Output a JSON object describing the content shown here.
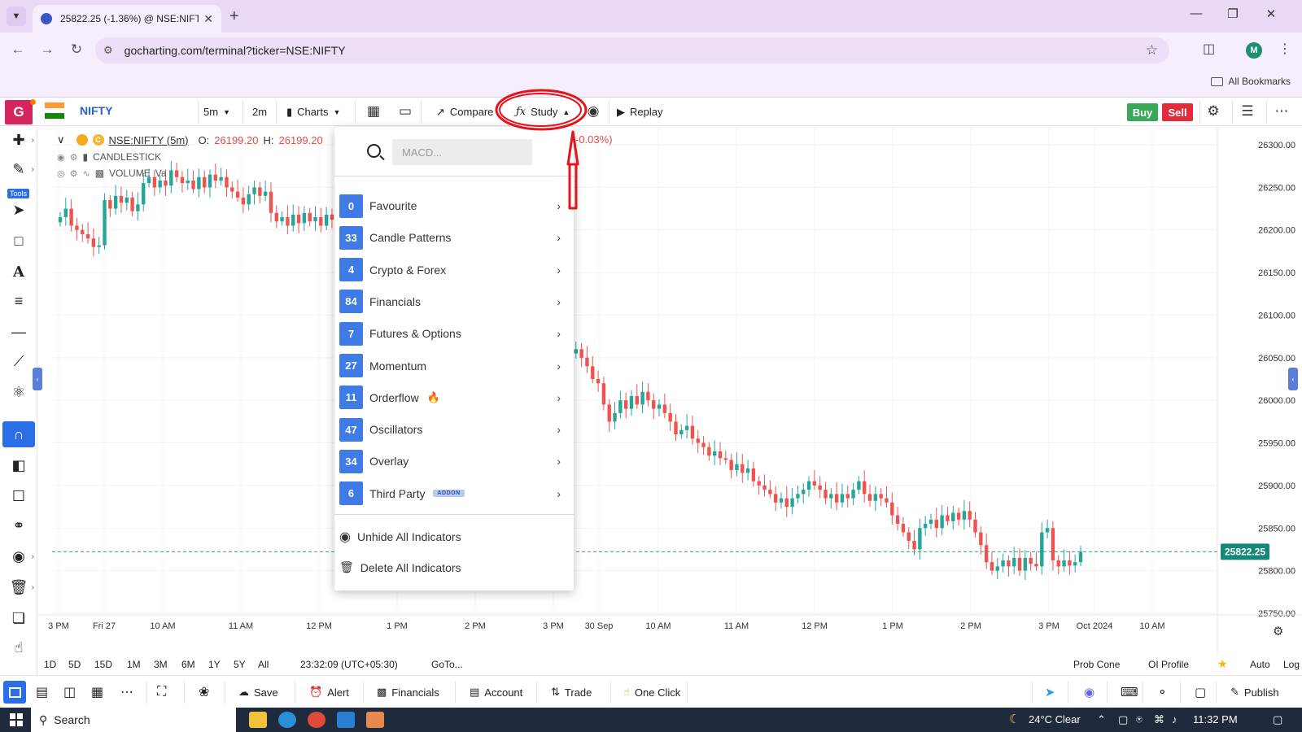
{
  "browser": {
    "tab_title": "25822.25 (-1.36%) @ NSE:NIFTY",
    "url": "gocharting.com/terminal?ticker=NSE:NIFTY",
    "profile_initial": "M",
    "bookmarks_label": "All Bookmarks"
  },
  "toolbar": {
    "logo": "G",
    "symbol": "NIFTY",
    "interval": "5m",
    "interval_alt": "2m",
    "charts_label": "Charts",
    "compare_label": "Compare",
    "study_label": "Study",
    "replay_label": "Replay",
    "buy_label": "Buy",
    "sell_label": "Sell"
  },
  "sidebar": {
    "tools_badge": "Tools"
  },
  "legend": {
    "ticker": "NSE:NIFTY (5m)",
    "open_label": "O:",
    "open_value": "26199.20",
    "high_label": "H:",
    "high_value": "26199.20",
    "change_tail": "-0.03%)",
    "candle_label": "CANDLESTICK",
    "volume_label": "VOLUME",
    "volume_tail": "Va"
  },
  "study_menu": {
    "search_placeholder": "MACD...",
    "categories": [
      {
        "count": "0",
        "label": "Favourite"
      },
      {
        "count": "33",
        "label": "Candle Patterns"
      },
      {
        "count": "4",
        "label": "Crypto & Forex"
      },
      {
        "count": "84",
        "label": "Financials"
      },
      {
        "count": "7",
        "label": "Futures & Options"
      },
      {
        "count": "27",
        "label": "Momentum"
      },
      {
        "count": "11",
        "label": "Orderflow"
      },
      {
        "count": "47",
        "label": "Oscillators"
      },
      {
        "count": "34",
        "label": "Overlay"
      },
      {
        "count": "6",
        "label": "Third Party"
      }
    ],
    "addon_badge": "ADDON",
    "unhide_label": "Unhide All Indicators",
    "delete_label": "Delete All Indicators"
  },
  "ranges": [
    "1D",
    "5D",
    "15D",
    "1M",
    "3M",
    "6M",
    "1Y",
    "5Y",
    "All"
  ],
  "clock": "23:32:09 (UTC+05:30)",
  "goto_label": "GoTo...",
  "range_right": {
    "prob_cone": "Prob Cone",
    "oi_profile": "OI Profile",
    "auto": "Auto",
    "log": "Log"
  },
  "footer": {
    "save": "Save",
    "alert": "Alert",
    "financials": "Financials",
    "account": "Account",
    "trade": "Trade",
    "one_click": "One Click",
    "publish": "Publish"
  },
  "taskbar": {
    "search": "Search",
    "weather": "24°C  Clear",
    "time": "11:32 PM"
  },
  "colors": {
    "up": "#26a69a",
    "down": "#ef5350",
    "accent": "#2a6ee8",
    "brand": "#d6245d"
  },
  "chart_data": {
    "type": "candlestick",
    "symbol": "NSE:NIFTY",
    "interval": "5m",
    "y_range": [
      25750,
      26300
    ],
    "y_ticks": [
      "26300.00",
      "26250.00",
      "26200.00",
      "26150.00",
      "26100.00",
      "26050.00",
      "26000.00",
      "25950.00",
      "25900.00",
      "25850.00",
      "25800.00",
      "25750.00"
    ],
    "x_ticks": [
      "3 PM",
      "Fri 27",
      "10 AM",
      "11 AM",
      "12 PM",
      "1 PM",
      "2 PM",
      "3 PM",
      "30 Sep",
      "10 AM",
      "11 AM",
      "12 PM",
      "1 PM",
      "2 PM",
      "3 PM",
      "Oct 2024",
      "10 AM"
    ],
    "last_price": "25822.25",
    "last_price_value": 25822.25,
    "closes": [
      26215,
      26225,
      26205,
      26200,
      26195,
      26190,
      26180,
      26182,
      26235,
      26225,
      26240,
      26232,
      26238,
      26222,
      26230,
      26255,
      26262,
      26250,
      26258,
      26252,
      26270,
      26262,
      26255,
      26258,
      26248,
      26262,
      26250,
      26265,
      26258,
      26262,
      26250,
      26245,
      26238,
      26230,
      26242,
      26250,
      26240,
      26245,
      26220,
      26210,
      26215,
      26205,
      26218,
      26208,
      26220,
      26210,
      26215,
      26205,
      26218,
      26212,
      26210,
      26215,
      26205,
      26210,
      26200,
      26212,
      26205,
      26230,
      26235,
      26240,
      26228,
      26232,
      26225,
      26230,
      26218,
      26222,
      26215,
      26220,
      26210,
      26212,
      26205,
      26200,
      26195,
      26198,
      26188,
      26192,
      26180,
      26178,
      26175,
      26165,
      26160,
      26158,
      26155,
      26175,
      26180,
      26170,
      26160,
      26165,
      26155,
      26080,
      26085,
      26070,
      26055,
      26060,
      26050,
      26040,
      26025,
      26020,
      25995,
      25975,
      25985,
      26000,
      25990,
      26005,
      25995,
      26010,
      26000,
      25990,
      25995,
      25985,
      25975,
      25960,
      25965,
      25970,
      25955,
      25950,
      25945,
      25935,
      25940,
      25932,
      25930,
      25918,
      25925,
      25915,
      25920,
      25905,
      25900,
      25895,
      25890,
      25880,
      25885,
      25875,
      25885,
      25890,
      25895,
      25905,
      25900,
      25895,
      25885,
      25890,
      25880,
      25890,
      25885,
      25895,
      25905,
      25890,
      25882,
      25890,
      25885,
      25880,
      25865,
      25855,
      25845,
      25835,
      25825,
      25850,
      25855,
      25860,
      25850,
      25865,
      25858,
      25868,
      25860,
      25870,
      25860,
      25845,
      25830,
      25810,
      25800,
      25805,
      25812,
      25805,
      25815,
      25800,
      25815,
      25808,
      25805,
      25845,
      25850,
      25812,
      25805,
      25812,
      25806,
      25810,
      25822.25
    ]
  }
}
